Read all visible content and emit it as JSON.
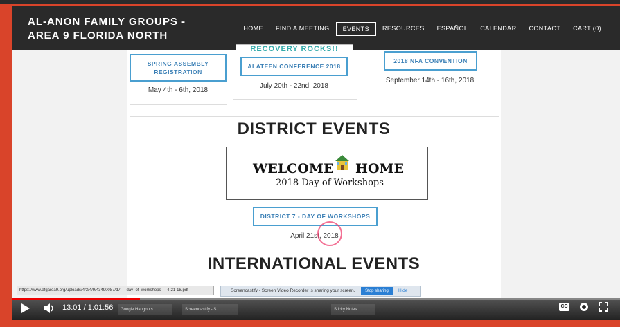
{
  "site": {
    "title_line1": "AL-ANON FAMILY GROUPS -",
    "title_line2": "AREA 9 FLORIDA NORTH"
  },
  "nav": [
    {
      "label": "HOME",
      "active": false
    },
    {
      "label": "FIND A MEETING",
      "active": false
    },
    {
      "label": "EVENTS",
      "active": true
    },
    {
      "label": "RESOURCES",
      "active": false
    },
    {
      "label": "ESPAÑOL",
      "active": false
    },
    {
      "label": "CALENDAR",
      "active": false
    },
    {
      "label": "CONTACT",
      "active": false
    },
    {
      "label": "CART (0)",
      "active": false
    }
  ],
  "area_events": {
    "recovery_text": "RECOVERY ROCKS!!",
    "items": [
      {
        "label_line1": "SPRING ASSEMBLY",
        "label_line2": "REGISTRATION",
        "date": "May 4th - 6th, 2018"
      },
      {
        "label_line1": "ALATEEN CONFERENCE 2018",
        "label_line2": "",
        "date": "July 20th - 22nd, 2018"
      },
      {
        "label_line1": "2018 NFA CONVENTION",
        "label_line2": "",
        "date": "September 14th - 16th, 2018"
      }
    ]
  },
  "district": {
    "heading": "DISTRICT EVENTS",
    "banner_line1_a": "WELCOME",
    "banner_line1_b": "HOME",
    "banner_line2": "2018 Day of Workshops",
    "button": "DISTRICT 7 - DAY OF WORKSHOPS",
    "date": "April 21st, 2018"
  },
  "international": {
    "heading": "INTERNATIONAL EVENTS"
  },
  "browser": {
    "status_url": "https://www.afgarea9.org/uploads/4/3/4/9/43490087/d7_-_day_of_workshops_-_4-21-18.pdf",
    "share_text": "Screencastify - Screen Video Recorder is sharing your screen.",
    "stop_label": "Stop sharing",
    "hide_label": "Hide"
  },
  "taskbar": {
    "items": [
      "Google Hangouts...",
      "Screencastify - S...",
      "Sticky Notes"
    ]
  },
  "player": {
    "time": "13:01 / 1:01:56",
    "progress": 0.21,
    "cc": "CC"
  }
}
